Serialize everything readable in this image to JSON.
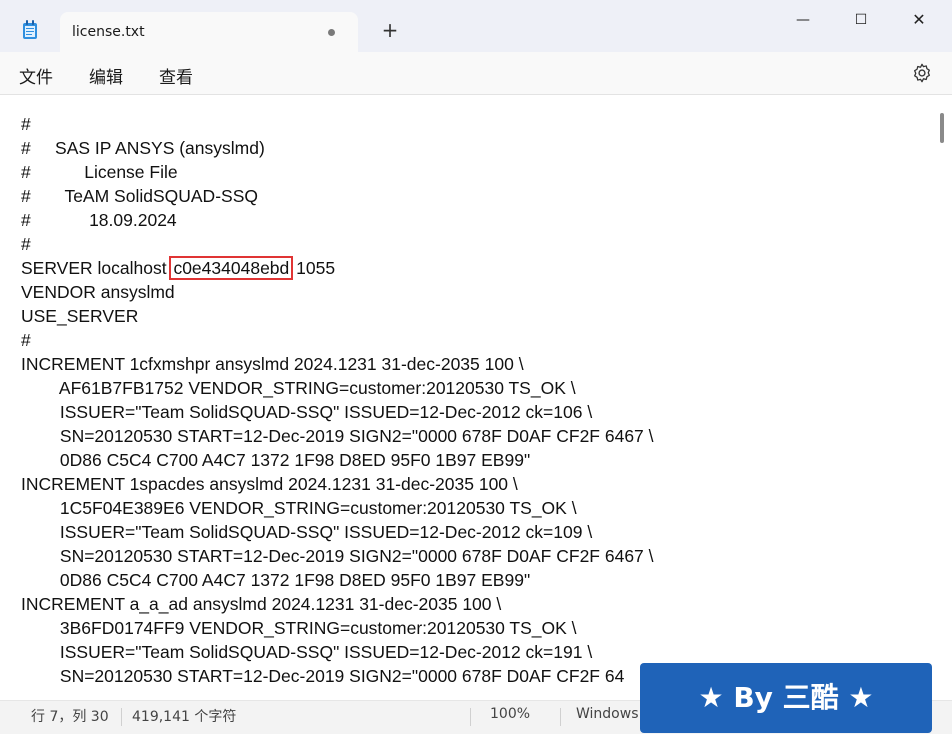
{
  "titlebar": {
    "tab_title": "license.txt",
    "new_tab": "+",
    "minimize": "—",
    "maximize": "☐",
    "close": "✕"
  },
  "menu": {
    "file": "文件",
    "edit": "编辑",
    "view": "查看"
  },
  "editor": {
    "lines": [
      "#",
      "#     SAS IP ANSYS (ansyslmd)",
      "#           License File",
      "#       TeAM SolidSQUAD-SSQ",
      "#            18.09.2024",
      "#",
      "SERVER localhost ",
      "VENDOR ansyslmd",
      "USE_SERVER",
      "#",
      "INCREMENT 1cfxmshpr ansyslmd 2024.1231 31-dec-2035 100 \\",
      "        AF61B7FB1752 VENDOR_STRING=customer:20120530 TS_OK \\",
      "        ISSUER=\"Team SolidSQUAD-SSQ\" ISSUED=12-Dec-2012 ck=106 \\",
      "        SN=20120530 START=12-Dec-2019 SIGN2=\"0000 678F D0AF CF2F 6467 \\",
      "        0D86 C5C4 C700 A4C7 1372 1F98 D8ED 95F0 1B97 EB99\"",
      "INCREMENT 1spacdes ansyslmd 2024.1231 31-dec-2035 100 \\",
      "        1C5F04E389E6 VENDOR_STRING=customer:20120530 TS_OK \\",
      "        ISSUER=\"Team SolidSQUAD-SSQ\" ISSUED=12-Dec-2012 ck=109 \\",
      "        SN=20120530 START=12-Dec-2019 SIGN2=\"0000 678F D0AF CF2F 6467 \\",
      "        0D86 C5C4 C700 A4C7 1372 1F98 D8ED 95F0 1B97 EB99\"",
      "INCREMENT a_a_ad ansyslmd 2024.1231 31-dec-2035 100 \\",
      "        3B6FD0174FF9 VENDOR_STRING=customer:20120530 TS_OK \\",
      "        ISSUER=\"Team SolidSQUAD-SSQ\" ISSUED=12-Dec-2012 ck=191 \\",
      "        SN=20120530 START=12-Dec-2019 SIGN2=\"0000 678F D0AF CF2F 64"
    ],
    "server_hostid": "c0e434048ebd",
    "server_port": " 1055"
  },
  "status": {
    "position": "行 7，列 30",
    "char_count": "419,141 个字符",
    "zoom": "100%",
    "line_ending": "Windows"
  },
  "watermark": {
    "text": "★ By 三酷 ★"
  },
  "colors": {
    "highlight_box": "#e03434",
    "watermark_bg": "#1f63b8"
  }
}
